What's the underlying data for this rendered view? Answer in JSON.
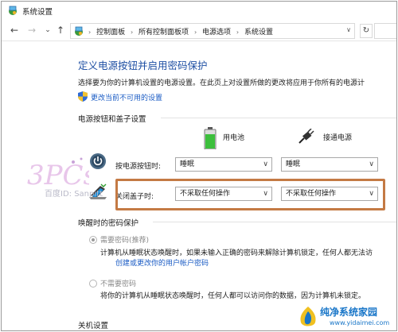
{
  "window": {
    "title": "系统设置"
  },
  "nav": {
    "back": "←",
    "forward": "→",
    "recent": "⌄",
    "up": "↑",
    "breadcrumbs": [
      "控制面板",
      "所有控制面板项",
      "电源选项",
      "系统设置"
    ],
    "refresh": "↻"
  },
  "page": {
    "heading": "定义电源按钮并启用密码保护",
    "description": "选择要为你的计算机设置的电源设置。在此页上对设置所做的更改将应用于你所有的电源计",
    "change_link": "更改当前不可用的设置"
  },
  "power_section": {
    "title": "电源按钮和盖子设置",
    "col_battery": "用电池",
    "col_plugged": "接通电源",
    "rows": [
      {
        "label": "按电源按钮时:",
        "battery": "睡眠",
        "plugged": "睡眠"
      },
      {
        "label": "关闭盖子时:",
        "battery": "不采取任何操作",
        "plugged": "不采取任何操作"
      }
    ]
  },
  "password_section": {
    "title": "唤醒时的密码保护",
    "option1": {
      "label": "需要密码(推荐)",
      "text": "计算机从睡眠状态唤醒时，如果未输入正确的密码来解除计算机锁定，任何人都无法访",
      "link": "创建或更改你的用户帐户密码"
    },
    "option2": {
      "label": "不需要密码",
      "text": "将你的计算机从睡眠状态唤醒时，任何人都可以访问你的数据，因为计算机未锁定。"
    }
  },
  "shutdown_section": {
    "title": "关机设置"
  },
  "watermark": {
    "text": "百度ID: Sanpitt",
    "logo_text": "3PCs"
  },
  "brand": {
    "name": "纯净系统家园",
    "url": "www.yidaimei.com"
  },
  "colors": {
    "accent": "#1e4fa3",
    "link": "#1a5bc4",
    "highlight": "#c47a44"
  },
  "icons": [
    "control-panel-icon",
    "shield-icon",
    "battery-icon",
    "plug-icon",
    "power-icon",
    "laptop-lid-icon"
  ]
}
